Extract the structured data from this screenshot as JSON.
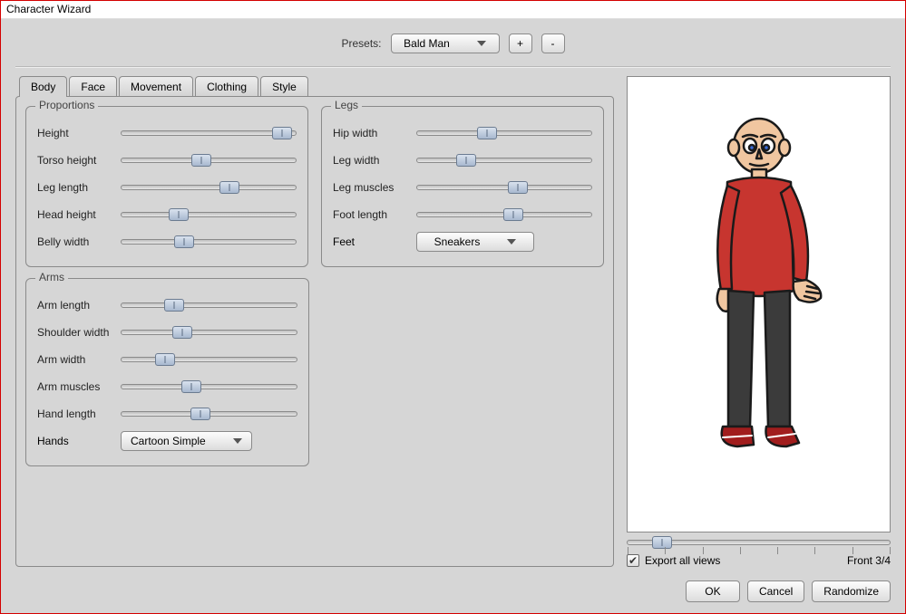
{
  "window": {
    "title": "Character Wizard"
  },
  "presets": {
    "label": "Presets:",
    "selected": "Bald Man",
    "plus": "+",
    "minus": "-"
  },
  "tabs": {
    "body": "Body",
    "face": "Face",
    "movement": "Movement",
    "clothing": "Clothing",
    "style": "Style",
    "active": "body"
  },
  "groups": {
    "proportions": {
      "legend": "Proportions",
      "sliders": {
        "height": {
          "label": "Height",
          "value": 0.92
        },
        "torso_height": {
          "label": "Torso height",
          "value": 0.46
        },
        "leg_length": {
          "label": "Leg length",
          "value": 0.62
        },
        "head_height": {
          "label": "Head height",
          "value": 0.33
        },
        "belly_width": {
          "label": "Belly width",
          "value": 0.36
        }
      }
    },
    "legs": {
      "legend": "Legs",
      "sliders": {
        "hip_width": {
          "label": "Hip width",
          "value": 0.4
        },
        "leg_width": {
          "label": "Leg width",
          "value": 0.28
        },
        "leg_muscles": {
          "label": "Leg muscles",
          "value": 0.58
        },
        "foot_length": {
          "label": "Foot length",
          "value": 0.55
        }
      },
      "feet_label": "Feet",
      "feet_selected": "Sneakers"
    },
    "arms": {
      "legend": "Arms",
      "sliders": {
        "arm_length": {
          "label": "Arm length",
          "value": 0.3
        },
        "shoulder_width": {
          "label": "Shoulder width",
          "value": 0.35
        },
        "arm_width": {
          "label": "Arm width",
          "value": 0.25
        },
        "arm_muscles": {
          "label": "Arm muscles",
          "value": 0.4
        },
        "hand_length": {
          "label": "Hand length",
          "value": 0.45
        }
      },
      "hands_label": "Hands",
      "hands_selected": "Cartoon Simple"
    }
  },
  "preview": {
    "view_value": 0.13,
    "export_label": "Export all views",
    "export_checked": true,
    "view_name": "Front 3/4"
  },
  "buttons": {
    "ok": "OK",
    "cancel": "Cancel",
    "randomize": "Randomize"
  },
  "colors": {
    "skin": "#f0c6a0",
    "shirt": "#c7352f",
    "pants": "#3b3b3b",
    "shoe": "#a11d1d",
    "outline": "#1a1a1a"
  }
}
